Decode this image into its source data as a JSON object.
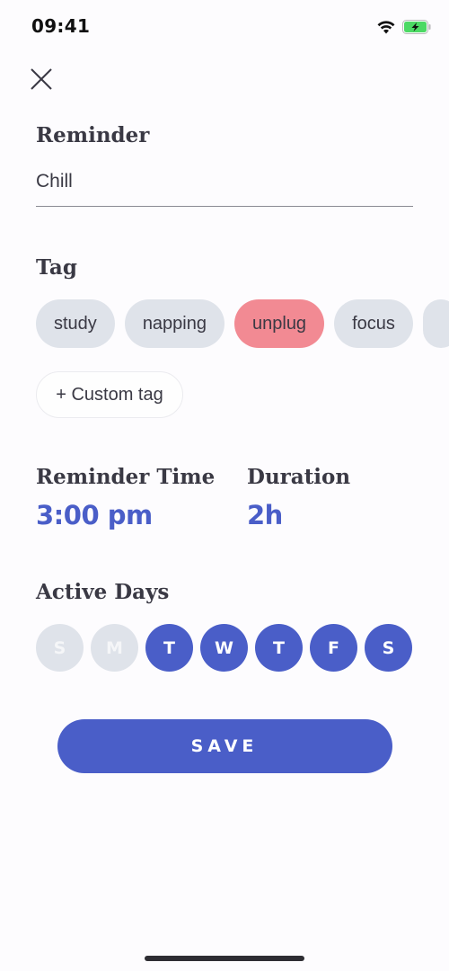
{
  "status_bar": {
    "time": "09:41",
    "icons": [
      "wifi-icon",
      "battery-charging-icon"
    ]
  },
  "header": {
    "close_icon": "close-icon"
  },
  "reminder": {
    "label": "Reminder",
    "value": "Chill"
  },
  "tag": {
    "label": "Tag",
    "items": [
      {
        "label": "study",
        "selected": false
      },
      {
        "label": "napping",
        "selected": false
      },
      {
        "label": "unplug",
        "selected": true
      },
      {
        "label": "focus",
        "selected": false
      },
      {
        "label": "",
        "selected": false
      }
    ],
    "custom_tag_label": "+ Custom tag"
  },
  "reminder_time": {
    "label": "Reminder Time",
    "value": "3:00 pm"
  },
  "duration": {
    "label": "Duration",
    "value": "2h"
  },
  "active_days": {
    "label": "Active Days",
    "days": [
      {
        "label": "S",
        "active": false
      },
      {
        "label": "M",
        "active": false
      },
      {
        "label": "T",
        "active": true
      },
      {
        "label": "W",
        "active": true
      },
      {
        "label": "T",
        "active": true
      },
      {
        "label": "F",
        "active": true
      },
      {
        "label": "S",
        "active": true
      }
    ]
  },
  "save_button": {
    "label": "SAVE"
  },
  "colors": {
    "accent": "#4a5ec8",
    "tag_selected": "#f28a93",
    "tag_default": "#dfe3ea",
    "battery": "#4cd964"
  }
}
